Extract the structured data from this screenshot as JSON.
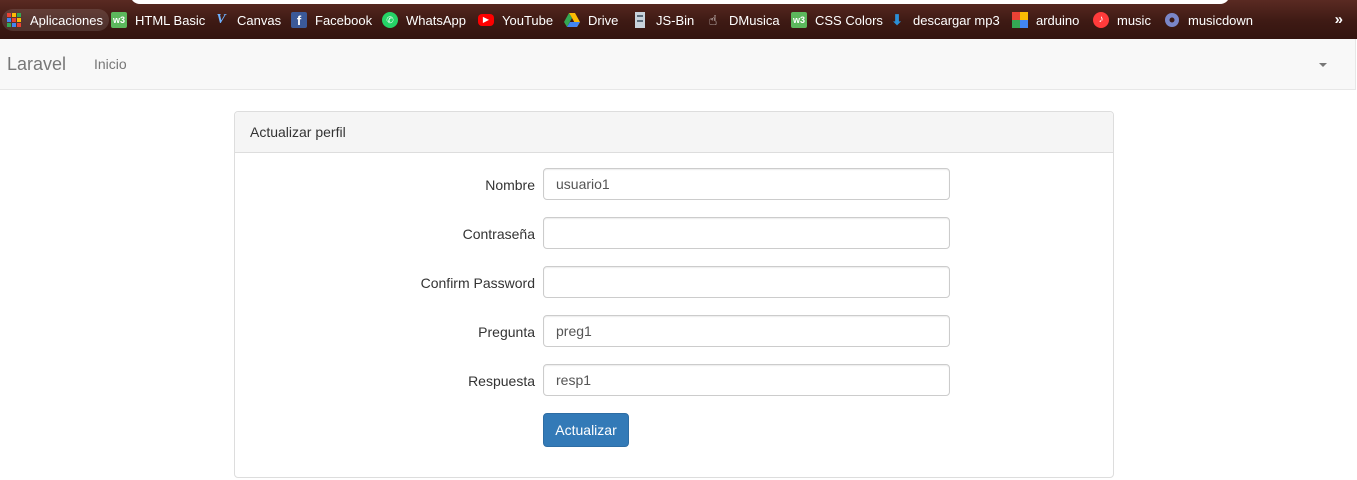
{
  "bookmarks": {
    "items": [
      {
        "label": "Aplicaciones",
        "icon": "apps-grid-icon"
      },
      {
        "label": "HTML Basic",
        "icon": "w3schools-icon",
        "color": "#5cb85c"
      },
      {
        "label": "Canvas",
        "icon": "canvas-v-icon",
        "color": "#3b8ed8"
      },
      {
        "label": "Facebook",
        "icon": "facebook-icon",
        "color": "#3b5998"
      },
      {
        "label": "WhatsApp",
        "icon": "whatsapp-icon",
        "color": "#25d366"
      },
      {
        "label": "YouTube",
        "icon": "youtube-icon",
        "color": "#ff0000"
      },
      {
        "label": "Drive",
        "icon": "google-drive-icon"
      },
      {
        "label": "JS-Bin",
        "icon": "jsbin-icon"
      },
      {
        "label": "DMusica",
        "icon": "hand-cursor-icon"
      },
      {
        "label": "CSS Colors",
        "icon": "w3schools-icon",
        "color": "#5cb85c"
      },
      {
        "label": "descargar mp3",
        "icon": "download-icon",
        "color": "#2b8fd6"
      },
      {
        "label": "arduino",
        "icon": "colorful-grid-icon"
      },
      {
        "label": "music",
        "icon": "music-note-icon",
        "color": "#ff3b3b"
      },
      {
        "label": "musicdown",
        "icon": "disc-icon"
      }
    ],
    "more": "»"
  },
  "navbar": {
    "brand": "Laravel",
    "link": "Inicio"
  },
  "panel": {
    "title": "Actualizar perfil",
    "fields": [
      {
        "label": "Nombre",
        "value": "usuario1"
      },
      {
        "label": "Contraseña",
        "value": ""
      },
      {
        "label": "Confirm Password",
        "value": ""
      },
      {
        "label": "Pregunta",
        "value": "preg1"
      },
      {
        "label": "Respuesta",
        "value": "resp1"
      }
    ],
    "submit": "Actualizar"
  },
  "colors": {
    "primary": "#337ab7",
    "bookmarks_bg": "#3e1a14",
    "navbar_bg": "#f8f8f8"
  }
}
